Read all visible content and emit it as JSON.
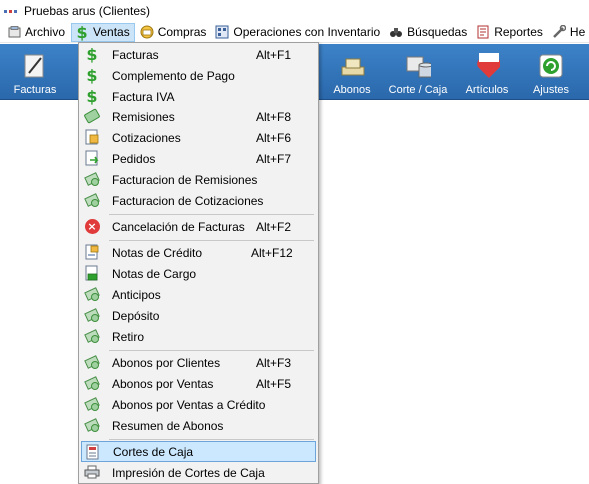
{
  "window": {
    "title": "Pruebas arus (Clientes)"
  },
  "menubar": [
    {
      "label": "Archivo",
      "icon": "archive-icon"
    },
    {
      "label": "Ventas",
      "icon": "dollar-icon",
      "active": true
    },
    {
      "label": "Compras",
      "icon": "purchases-icon"
    },
    {
      "label": "Operaciones con Inventario",
      "icon": "inventory-icon"
    },
    {
      "label": "Búsquedas",
      "icon": "binoculars-icon"
    },
    {
      "label": "Reportes",
      "icon": "report-icon"
    },
    {
      "label": "He",
      "icon": "tools-icon"
    }
  ],
  "toolbar": [
    {
      "label": "Facturas",
      "icon": "invoice-pen-icon"
    },
    {
      "label": "Abonos",
      "icon": "cash-icon"
    },
    {
      "label": "Corte / Caja",
      "icon": "cash-register-icon"
    },
    {
      "label": "Artículos",
      "icon": "abc-heart-icon"
    },
    {
      "label": "Ajustes",
      "icon": "adjust-icon"
    }
  ],
  "ventas_menu": [
    {
      "label": "Facturas",
      "shortcut": "Alt+F1",
      "icon": "dollar-icon"
    },
    {
      "label": "Complemento de Pago",
      "shortcut": "",
      "icon": "dollar-icon"
    },
    {
      "label": "Factura IVA",
      "shortcut": "",
      "icon": "dollar-icon"
    },
    {
      "label": "Remisiones",
      "shortcut": "Alt+F8",
      "icon": "money-icon"
    },
    {
      "label": "Cotizaciones",
      "shortcut": "Alt+F6",
      "icon": "quote-icon"
    },
    {
      "label": "Pedidos",
      "shortcut": "Alt+F7",
      "icon": "order-icon"
    },
    {
      "label": "Facturacion de Remisiones",
      "shortcut": "",
      "icon": "money-stack-icon"
    },
    {
      "label": "Facturacion de Cotizaciones",
      "shortcut": "",
      "icon": "money-stack-icon"
    },
    {
      "label": "Cancelación de Facturas",
      "shortcut": "Alt+F2",
      "icon": "cancel-icon"
    },
    {
      "label": "Notas de Crédito",
      "shortcut": "Alt+F12",
      "icon": "credit-note-icon"
    },
    {
      "label": "Notas de Cargo",
      "shortcut": "",
      "icon": "charge-note-icon"
    },
    {
      "label": "Anticipos",
      "shortcut": "",
      "icon": "money-stack-icon"
    },
    {
      "label": "Depósito",
      "shortcut": "",
      "icon": "money-stack-icon"
    },
    {
      "label": "Retiro",
      "shortcut": "",
      "icon": "money-stack-icon"
    },
    {
      "label": "Abonos por Clientes",
      "shortcut": "Alt+F3",
      "icon": "money-stack-icon"
    },
    {
      "label": "Abonos por Ventas",
      "shortcut": "Alt+F5",
      "icon": "money-stack-icon"
    },
    {
      "label": "Abonos por Ventas a Crédito",
      "shortcut": "",
      "icon": "money-stack-icon"
    },
    {
      "label": "Resumen de Abonos",
      "shortcut": "",
      "icon": "money-stack-icon"
    },
    {
      "label": "Cortes de Caja",
      "shortcut": "",
      "icon": "cash-report-icon",
      "highlighted": true
    },
    {
      "label": "Impresión de Cortes de Caja",
      "shortcut": "",
      "icon": "printer-icon"
    }
  ]
}
